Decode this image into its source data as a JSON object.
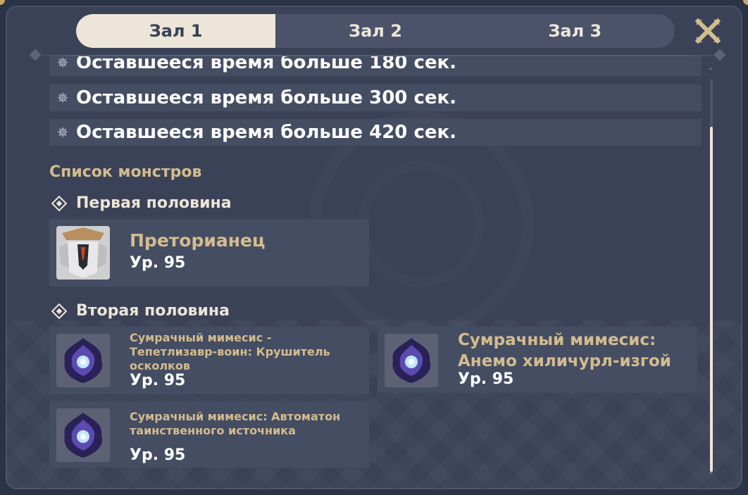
{
  "tabs": [
    {
      "label": "Зал 1",
      "active": true
    },
    {
      "label": "Зал 2",
      "active": false
    },
    {
      "label": "Зал 3",
      "active": false
    }
  ],
  "close_icon": "close-x-icon",
  "conditions": [
    {
      "text": "Оставшееся время больше 180 сек."
    },
    {
      "text": "Оставшееся время больше 300 сек."
    },
    {
      "text": "Оставшееся время больше 420 сек."
    }
  ],
  "monster_list_title": "Список монстров",
  "first_half": {
    "title": "Первая половина",
    "monsters": [
      {
        "name": "Преторианец",
        "level": "Ур. 95"
      }
    ]
  },
  "second_half": {
    "title": "Вторая половина",
    "monsters": [
      {
        "name": "Сумрачный мимесис - Тепетлизавр-воин: Крушитель осколков",
        "level": "Ур. 95"
      },
      {
        "name": "Сумрачный мимесис: Анемо хиличурл-изгой",
        "level": "Ур. 95"
      },
      {
        "name": "Сумрачный мимесис: Автоматон таинственного источника",
        "level": "Ур. 95"
      }
    ]
  },
  "colors": {
    "accent_gold": "#d3bc8e",
    "panel_bg": "#3b4257",
    "tab_active_bg": "#ece5d8"
  }
}
